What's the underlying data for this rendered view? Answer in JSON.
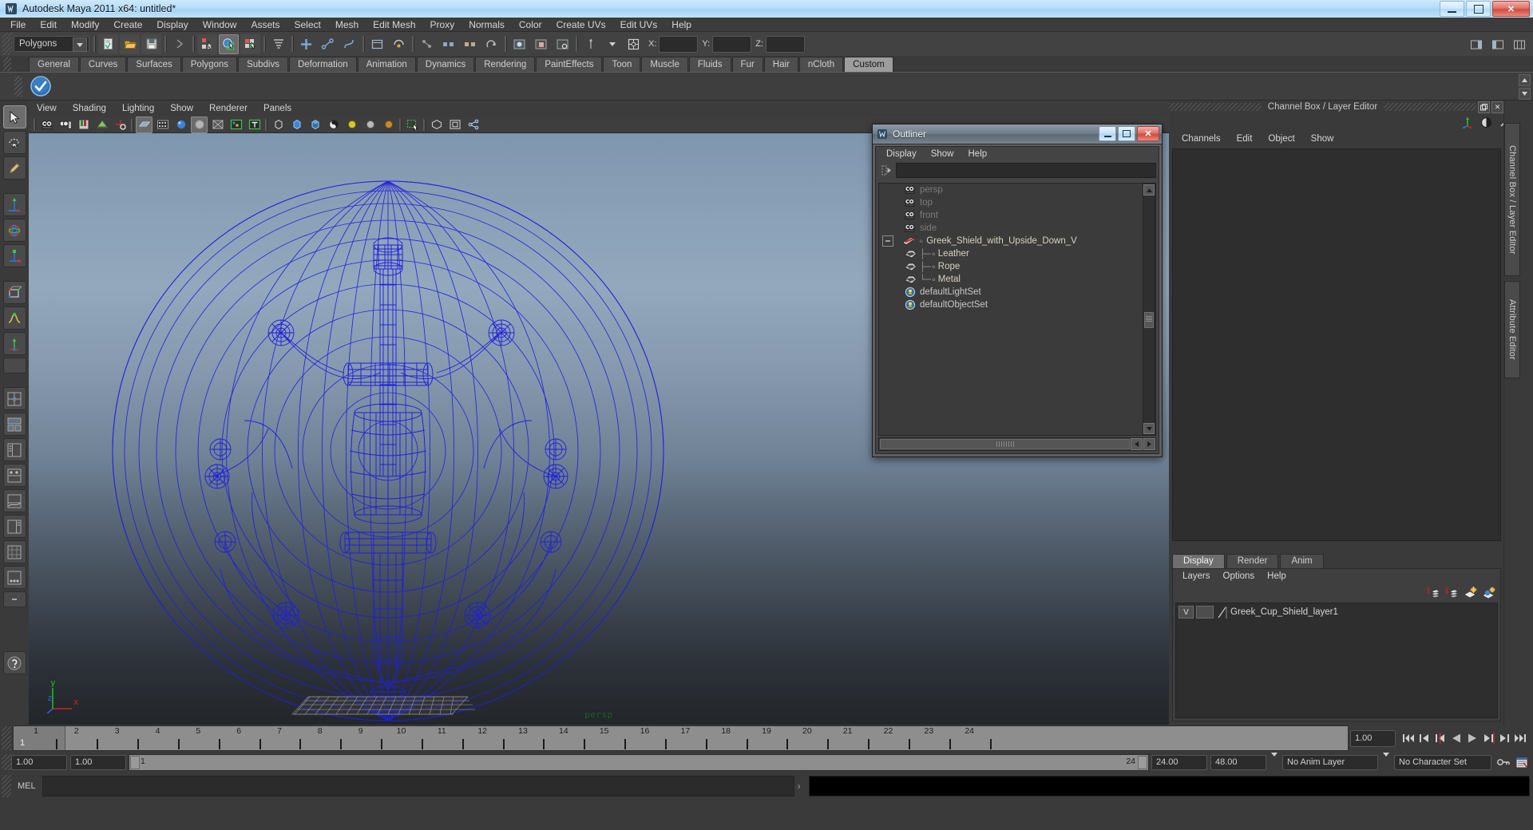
{
  "window": {
    "title": "Autodesk Maya 2011 x64: untitled*",
    "app_icon": "maya-icon",
    "buttons": {
      "minimize": "minimize-icon",
      "maximize": "restore-icon",
      "close": "✕"
    }
  },
  "menubar": {
    "items": [
      "File",
      "Edit",
      "Modify",
      "Create",
      "Display",
      "Window",
      "Assets",
      "Select",
      "Mesh",
      "Edit Mesh",
      "Proxy",
      "Normals",
      "Color",
      "Create UVs",
      "Edit UVs",
      "Help"
    ]
  },
  "statusline": {
    "mode_menu": "Polygons",
    "coord_labels": {
      "x": "X:",
      "y": "Y:",
      "z": "Z:"
    },
    "coord_values": {
      "x": "",
      "y": "",
      "z": ""
    }
  },
  "shelf": {
    "tabs": [
      "General",
      "Curves",
      "Surfaces",
      "Polygons",
      "Subdivs",
      "Deformation",
      "Animation",
      "Dynamics",
      "Rendering",
      "PaintEffects",
      "Toon",
      "Muscle",
      "Fluids",
      "Fur",
      "Hair",
      "nCloth",
      "Custom"
    ],
    "active_tab": "Custom",
    "buttons": [
      "check-mark-icon"
    ]
  },
  "viewport": {
    "menu": [
      "View",
      "Shading",
      "Lighting",
      "Show",
      "Renderer",
      "Panels"
    ],
    "camera_label": "persp",
    "axis": {
      "x": "x",
      "y": "y",
      "z": "z"
    },
    "axis_colors": {
      "x": "#d02020",
      "y": "#16c216",
      "z": "#2a5ef0"
    },
    "wireframe_color": "#1f1fe0",
    "model": "Greek shield with upside-down sword wireframe"
  },
  "outliner": {
    "title": "Outliner",
    "menu": [
      "Display",
      "Show",
      "Help"
    ],
    "search_value": "",
    "items": [
      {
        "label": "persp",
        "icon": "camera-icon",
        "style": "dim",
        "indent": 0
      },
      {
        "label": "top",
        "icon": "camera-icon",
        "style": "dim",
        "indent": 0
      },
      {
        "label": "front",
        "icon": "camera-icon",
        "style": "dim",
        "indent": 0
      },
      {
        "label": "side",
        "icon": "camera-icon",
        "style": "dim",
        "indent": 0
      },
      {
        "label": "Greek_Shield_with_Upside_Down_V",
        "icon": "group-transform-icon",
        "style": "normal",
        "indent": 0,
        "expanded": true
      },
      {
        "label": "Leather",
        "icon": "mesh-icon",
        "style": "normal",
        "indent": 1
      },
      {
        "label": "Rope",
        "icon": "mesh-icon",
        "style": "normal",
        "indent": 1
      },
      {
        "label": "Metal",
        "icon": "mesh-icon",
        "style": "normal",
        "indent": 1
      },
      {
        "label": "defaultLightSet",
        "icon": "set-icon",
        "style": "normal",
        "indent": 0
      },
      {
        "label": "defaultObjectSet",
        "icon": "set-icon",
        "style": "normal",
        "indent": 0
      }
    ]
  },
  "channel_box": {
    "dock_title": "Channel Box / Layer Editor",
    "menu": [
      "Channels",
      "Edit",
      "Object",
      "Show"
    ],
    "content": "",
    "vertical_tabs": [
      "Channel Box / Layer Editor",
      "Attribute Editor"
    ]
  },
  "layer_editor": {
    "tabs": [
      "Display",
      "Render",
      "Anim"
    ],
    "active_tab": "Display",
    "menu": [
      "Layers",
      "Options",
      "Help"
    ],
    "layers": [
      {
        "visibility": "V",
        "display_type": "",
        "name": "Greek_Cup_Shield_layer1"
      }
    ]
  },
  "timeline": {
    "ticks": [
      "1",
      "2",
      "3",
      "4",
      "5",
      "6",
      "7",
      "8",
      "9",
      "10",
      "11",
      "12",
      "13",
      "14",
      "15",
      "16",
      "17",
      "18",
      "19",
      "20",
      "21",
      "22",
      "23",
      "24"
    ],
    "current_frame_marker": "1",
    "current_frame_field": "1.00",
    "playback_buttons": [
      "go-to-start-icon",
      "step-back-key-icon",
      "step-back-frame-icon",
      "play-backwards-icon",
      "play-forwards-icon",
      "step-forward-frame-icon",
      "step-forward-key-icon",
      "go-to-end-icon"
    ]
  },
  "range_slider": {
    "anim_start": "1.00",
    "range_start": "1.00",
    "range_bar_start": "1",
    "range_bar_end": "24",
    "range_end": "24.00",
    "anim_end": "48.00",
    "anim_layer": "No Anim Layer",
    "character_set": "No Character Set"
  },
  "command_line": {
    "label": "MEL",
    "input_value": "",
    "output_value": ""
  },
  "colors": {
    "accent_blue": "#a4d3f5",
    "panel_bg": "#3a3a3a",
    "field_bg": "#2b2b2b",
    "wireframe": "#1f1fe0",
    "persp_label": "#1c5c2a"
  }
}
